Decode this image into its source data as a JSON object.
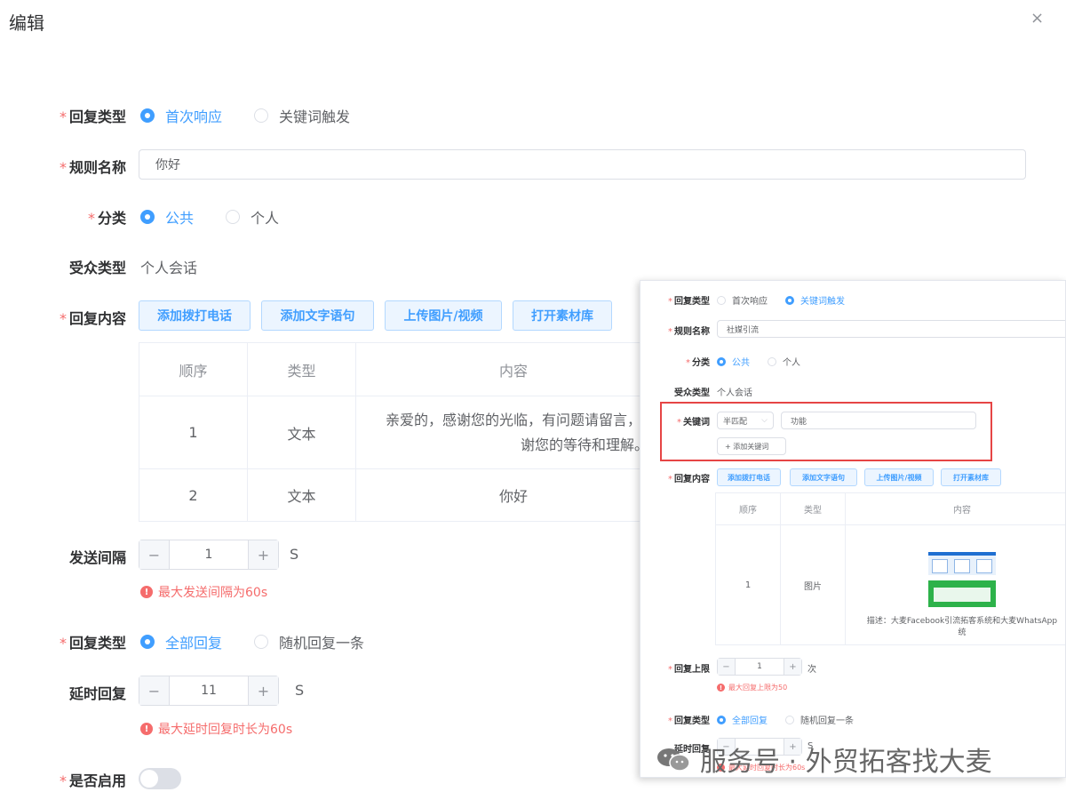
{
  "dialog": {
    "title": "编辑",
    "close": "×"
  },
  "form": {
    "reply_type": {
      "label": "回复类型",
      "options": [
        "首次响应",
        "关键词触发"
      ],
      "selected": 0
    },
    "rule_name": {
      "label": "规则名称",
      "value": "你好"
    },
    "category": {
      "label": "分类",
      "options": [
        "公共",
        "个人"
      ],
      "selected": 0
    },
    "audience": {
      "label": "受众类型",
      "value": "个人会话"
    },
    "content": {
      "label": "回复内容",
      "buttons": [
        "添加拨打电话",
        "添加文字语句",
        "上传图片/视频",
        "打开素材库"
      ],
      "columns": [
        "顺序",
        "类型",
        "内容"
      ],
      "rows": [
        {
          "order": "1",
          "type": "文本",
          "text": "亲爱的，感谢您的光临，有问题请留言，",
          "text2": "谢您的等待和理解。"
        },
        {
          "order": "2",
          "type": "文本",
          "text": "你好"
        }
      ]
    },
    "interval": {
      "label": "发送间隔",
      "value": "1",
      "unit": "S",
      "error": "最大发送间隔为60s"
    },
    "reply_mode": {
      "label": "回复类型",
      "options": [
        "全部回复",
        "随机回复一条"
      ],
      "selected": 0
    },
    "delay": {
      "label": "延时回复",
      "value": "11",
      "unit": "S",
      "error": "最大延时回复时长为60s"
    },
    "enabled": {
      "label": "是否启用",
      "on": false
    }
  },
  "inset": {
    "reply_type": {
      "label": "回复类型",
      "options": [
        "首次响应",
        "关键词触发"
      ],
      "selected": 1
    },
    "rule_name": {
      "label": "规则名称",
      "value": "社媒引流"
    },
    "category": {
      "label": "分类",
      "options": [
        "公共",
        "个人"
      ],
      "selected": 0
    },
    "audience": {
      "label": "受众类型",
      "value": "个人会话"
    },
    "keyword": {
      "label": "关键词",
      "match": "半匹配",
      "value": "功能",
      "add": "+ 添加关键词"
    },
    "content": {
      "label": "回复内容",
      "buttons": [
        "添加拨打电话",
        "添加文字语句",
        "上传图片/视频",
        "打开素材库"
      ],
      "columns": [
        "顺序",
        "类型",
        "内容"
      ],
      "row": {
        "order": "1",
        "type": "图片",
        "desc": "描述：大麦Facebook引流拓客系统和大麦WhatsApp",
        "desc2": "统"
      }
    },
    "limit": {
      "label": "回复上限",
      "value": "1",
      "unit": "次",
      "error": "最大回复上限为50"
    },
    "reply_mode": {
      "label": "回复类型",
      "options": [
        "全部回复",
        "随机回复一条"
      ]
    },
    "delay": {
      "label": "延时回复",
      "unit": "S",
      "error": "最大延时回复时长为60s"
    }
  },
  "watermark": "服务号 · 外贸拓客找大麦",
  "colors": {
    "primary": "#409eff",
    "danger": "#f56c6c",
    "highlight": "#e64545"
  }
}
